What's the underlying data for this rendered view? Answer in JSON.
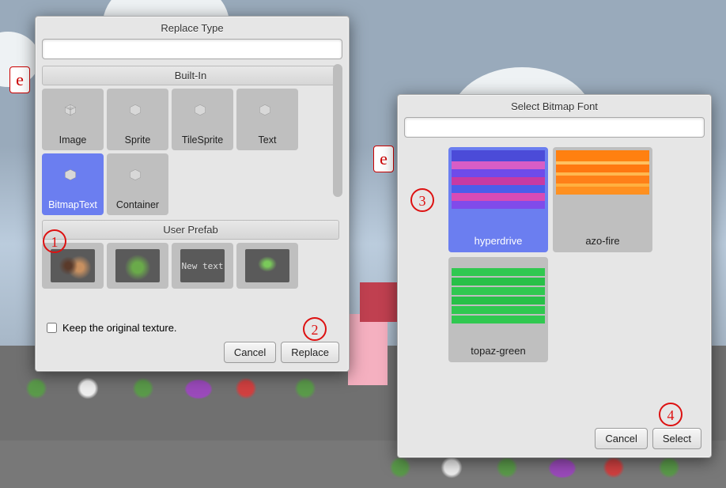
{
  "bg": {
    "label_e": "e"
  },
  "dialog1": {
    "title": "Replace Type",
    "search_placeholder": "",
    "sections": {
      "builtin": {
        "header": "Built-In",
        "tiles": [
          {
            "label": "Image",
            "selected": false
          },
          {
            "label": "Sprite",
            "selected": false
          },
          {
            "label": "TileSprite",
            "selected": false
          },
          {
            "label": "Text",
            "selected": false
          },
          {
            "label": "BitmapText",
            "selected": true
          },
          {
            "label": "Container",
            "selected": false
          }
        ]
      },
      "userprefab": {
        "header": "User Prefab",
        "new_text_label": "New text"
      }
    },
    "keep_texture_label": "Keep the original texture.",
    "buttons": {
      "cancel": "Cancel",
      "replace": "Replace"
    }
  },
  "dialog2": {
    "title": "Select Bitmap Font",
    "search_placeholder": "",
    "fonts": [
      {
        "label": "hyperdrive",
        "selected": true
      },
      {
        "label": "azo-fire",
        "selected": false
      },
      {
        "label": "topaz-green",
        "selected": false
      }
    ],
    "buttons": {
      "cancel": "Cancel",
      "select": "Select"
    }
  },
  "annotations": {
    "a1": "1",
    "a2": "2",
    "a3": "3",
    "a4": "4"
  }
}
